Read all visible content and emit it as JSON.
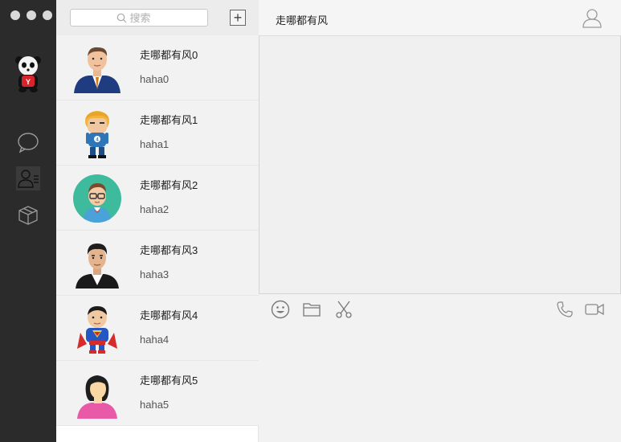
{
  "window": {
    "controls": [
      "close",
      "minimize",
      "zoom"
    ]
  },
  "sidebar": {
    "profile_avatar": "panda-avatar",
    "nav": [
      {
        "icon": "chat-bubble-icon",
        "active": false
      },
      {
        "icon": "contacts-icon",
        "active": true
      },
      {
        "icon": "box-icon",
        "active": false
      }
    ]
  },
  "search": {
    "placeholder": "搜索"
  },
  "add_button": {
    "label": "+"
  },
  "contacts": [
    {
      "name": "走哪都有风0",
      "message": "haha0",
      "avatar": "businessman-avatar"
    },
    {
      "name": "走哪都有风1",
      "message": "haha1",
      "avatar": "blonde-hero-avatar"
    },
    {
      "name": "走哪都有风2",
      "message": "haha2",
      "avatar": "nerd-circle-avatar"
    },
    {
      "name": "走哪都有风3",
      "message": "haha3",
      "avatar": "suit-man-avatar"
    },
    {
      "name": "走哪都有风4",
      "message": "haha4",
      "avatar": "superhero-avatar"
    },
    {
      "name": "走哪都有风5",
      "message": "haha5",
      "avatar": "woman-avatar"
    }
  ],
  "chat": {
    "title": "走哪都有风",
    "toolbar": [
      "emoji-icon",
      "folder-icon",
      "scissors-icon",
      "phone-icon",
      "video-icon"
    ]
  },
  "colors": {
    "sidebar": "#2b2b2b",
    "list_bg": "#f2f2f2",
    "accent_teal": "#3dbb9c"
  }
}
